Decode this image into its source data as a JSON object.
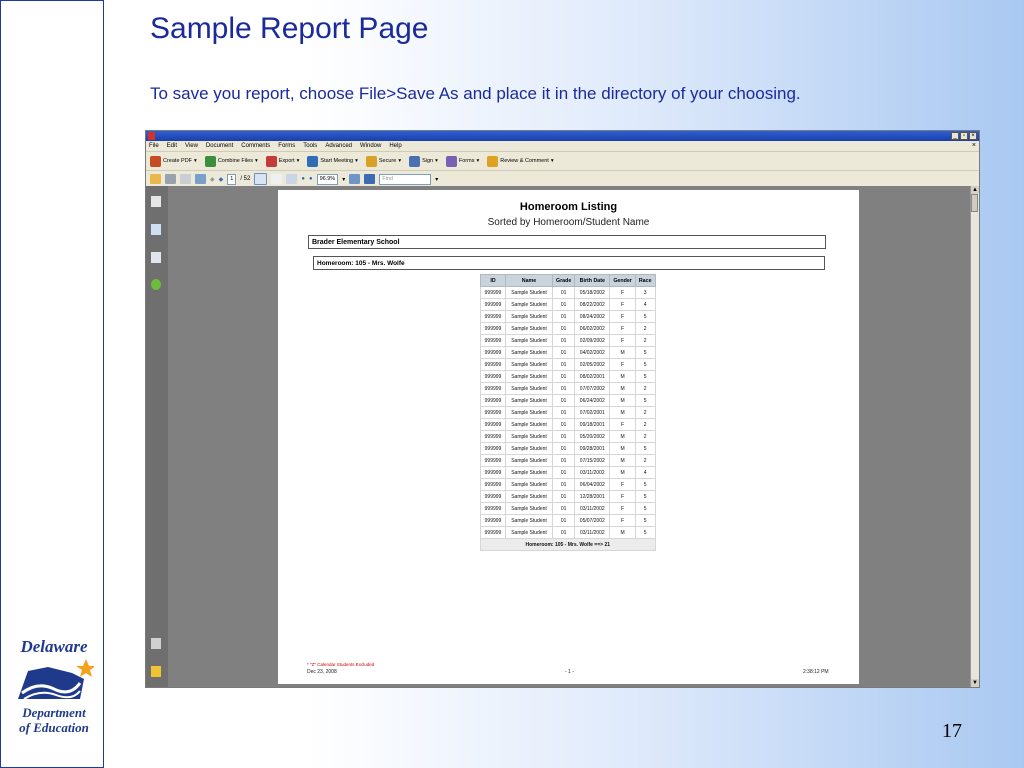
{
  "slide": {
    "title": "Sample Report Page",
    "instruction": "To save you report, choose File>Save As and place it in the directory of your choosing.",
    "page_number": "17"
  },
  "logo": {
    "line1": "Delaware",
    "line2": "Department",
    "line3": "of Education",
    "colors": {
      "navy": "#1f3a8a",
      "star": "#f4a21a"
    }
  },
  "window": {
    "title": "",
    "buttons": {
      "minimize": "_",
      "restore": "▫",
      "close": "×"
    },
    "menu": [
      "File",
      "Edit",
      "View",
      "Document",
      "Comments",
      "Forms",
      "Tools",
      "Advanced",
      "Window",
      "Help"
    ],
    "menu_close": "×",
    "toolbar1": [
      {
        "label": "Create PDF",
        "icon": "create-pdf-icon",
        "color": "#c64b22"
      },
      {
        "label": "Combine Files",
        "icon": "combine-files-icon",
        "color": "#3b8f3b"
      },
      {
        "label": "Export",
        "icon": "export-icon",
        "color": "#c63a3a"
      },
      {
        "label": "Start Meeting",
        "icon": "start-meeting-icon",
        "color": "#2f6db5"
      },
      {
        "label": "Secure",
        "icon": "secure-lock-icon",
        "color": "#d9a126"
      },
      {
        "label": "Sign",
        "icon": "sign-pen-icon",
        "color": "#4a6fb3"
      },
      {
        "label": "Forms",
        "icon": "forms-icon",
        "color": "#7a5fb5"
      },
      {
        "label": "Review & Comment",
        "icon": "review-comment-icon",
        "color": "#e0a020"
      }
    ],
    "nav": {
      "page_current": "1",
      "page_total": "/ 52",
      "zoom": "96.9%",
      "find_placeholder": "Find"
    }
  },
  "report": {
    "title": "Homeroom Listing",
    "subtitle": "Sorted by Homeroom/Student Name",
    "school": "Brader Elementary School",
    "homeroom": "Homeroom:  105 - Mrs. Wolfe",
    "columns": [
      "ID",
      "Name",
      "Grade",
      "Birth Date",
      "Gender",
      "Race"
    ],
    "rows": [
      [
        "999999",
        "Sample Student",
        "01",
        "05/18/2002",
        "F",
        "3"
      ],
      [
        "999999",
        "Sample Student",
        "01",
        "08/22/2002",
        "F",
        "4"
      ],
      [
        "999999",
        "Sample Student",
        "01",
        "08/24/2002",
        "F",
        "5"
      ],
      [
        "999999",
        "Sample Student",
        "01",
        "06/02/2002",
        "F",
        "2"
      ],
      [
        "999999",
        "Sample Student",
        "01",
        "02/09/2002",
        "F",
        "2"
      ],
      [
        "999999",
        "Sample Student",
        "01",
        "04/02/2002",
        "M",
        "5"
      ],
      [
        "999999",
        "Sample Student",
        "01",
        "02/05/2002",
        "F",
        "5"
      ],
      [
        "999999",
        "Sample Student",
        "01",
        "08/02/2001",
        "M",
        "5"
      ],
      [
        "999999",
        "Sample Student",
        "01",
        "07/07/2002",
        "M",
        "2"
      ],
      [
        "999999",
        "Sample Student",
        "01",
        "06/24/2002",
        "M",
        "5"
      ],
      [
        "999999",
        "Sample Student",
        "01",
        "07/02/2001",
        "M",
        "2"
      ],
      [
        "999999",
        "Sample Student",
        "01",
        "09/18/2001",
        "F",
        "2"
      ],
      [
        "999999",
        "Sample Student",
        "01",
        "05/20/2002",
        "M",
        "2"
      ],
      [
        "999999",
        "Sample Student",
        "01",
        "09/28/2001",
        "M",
        "5"
      ],
      [
        "999999",
        "Sample Student",
        "01",
        "07/15/2002",
        "M",
        "2"
      ],
      [
        "999999",
        "Sample Student",
        "01",
        "03/11/2002",
        "M",
        "4"
      ],
      [
        "999999",
        "Sample Student",
        "01",
        "06/04/2002",
        "F",
        "5"
      ],
      [
        "999999",
        "Sample Student",
        "01",
        "12/28/2001",
        "F",
        "5"
      ],
      [
        "999999",
        "Sample Student",
        "01",
        "03/11/2002",
        "F",
        "5"
      ],
      [
        "999999",
        "Sample Student",
        "01",
        "05/07/2002",
        "F",
        "5"
      ],
      [
        "999999",
        "Sample Student",
        "01",
        "03/11/2002",
        "M",
        "5"
      ]
    ],
    "total": "Homeroom:  105 - Mrs. Wolfe  ==>  21",
    "footnote": "* \"Z\" Calendar Students Excluded",
    "footer_date": "Dec 23, 2008",
    "footer_page": "- 1 -",
    "footer_time": "2:38:12 PM"
  }
}
